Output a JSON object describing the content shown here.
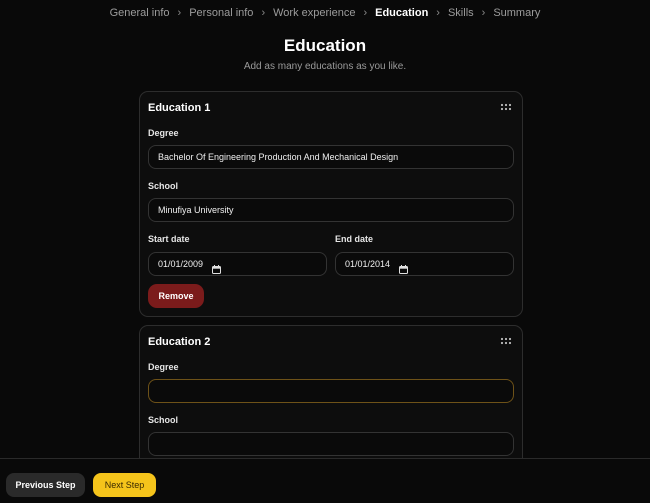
{
  "breadcrumb": {
    "items": [
      {
        "label": "General info"
      },
      {
        "label": "Personal info"
      },
      {
        "label": "Work experience"
      },
      {
        "label": "Education"
      },
      {
        "label": "Skills"
      },
      {
        "label": "Summary"
      }
    ],
    "active": "Education",
    "separator": "›"
  },
  "header": {
    "title": "Education",
    "subtitle": "Add as many educations as you like."
  },
  "educations": [
    {
      "title": "Education 1",
      "degree_label": "Degree",
      "degree_value": "Bachelor Of Engineering Production And Mechanical Design",
      "school_label": "School",
      "school_value": "Minufiya University",
      "start_label": "Start date",
      "start_value": "01/01/2009",
      "end_label": "End date",
      "end_value": "01/01/2014",
      "remove_label": "Remove"
    },
    {
      "title": "Education 2",
      "degree_label": "Degree",
      "degree_value": "",
      "school_label": "School",
      "school_value": ""
    }
  ],
  "footer": {
    "prev_label": "Previous Step",
    "next_label": "Next Step"
  },
  "colors": {
    "background": "#090909",
    "accent": "#f5c41b",
    "danger": "#7b1b1b",
    "focus_border": "#6e5218"
  },
  "icons": {
    "drag": "grip-dots-icon",
    "calendar": "calendar-icon"
  }
}
